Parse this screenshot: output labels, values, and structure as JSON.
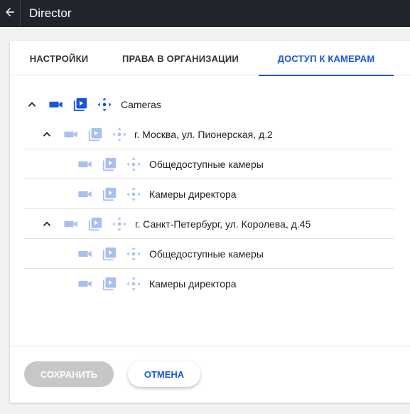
{
  "header": {
    "title": "Director"
  },
  "tabs": [
    {
      "label": "НАСТРОЙКИ"
    },
    {
      "label": "ПРАВА В ОРГАНИЗАЦИИ"
    },
    {
      "label": "ДОСТУП К КАМЕРАМ",
      "active": true
    }
  ],
  "tree": {
    "root": {
      "label": "Cameras",
      "expanded": true
    },
    "groups": [
      {
        "label": "г. Москва, ул. Пионерская, д.2",
        "expanded": true,
        "children": [
          {
            "label": "Общедоступные камеры"
          },
          {
            "label": "Камеры директора"
          }
        ]
      },
      {
        "label": "г. Санкт-Петербург, ул. Королева, д.45",
        "expanded": true,
        "children": [
          {
            "label": "Общедоступные камеры"
          },
          {
            "label": "Камеры директора"
          }
        ]
      }
    ],
    "icons": [
      "camera-icon",
      "playback-icon",
      "ptz-icon",
      "chevron-up-icon"
    ]
  },
  "footer": {
    "save_label": "СОХРАНИТЬ",
    "cancel_label": "ОТМЕНА"
  },
  "colors": {
    "accent": "#1a56db",
    "icon_active": "#1a56db",
    "icon_inactive": "#a9bff0",
    "topbar": "#21252b",
    "save_disabled": "#c7c7c7"
  }
}
